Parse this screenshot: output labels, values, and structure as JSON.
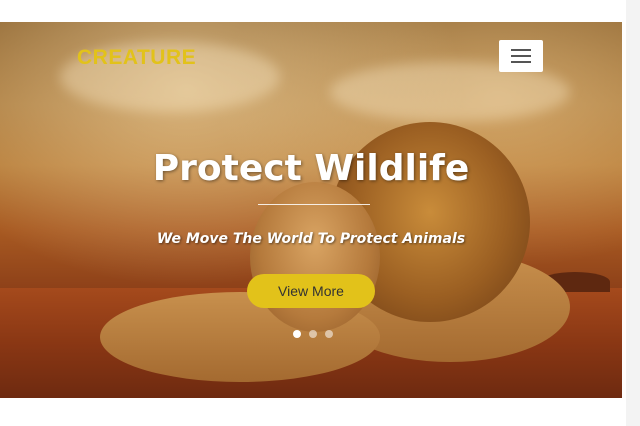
{
  "header": {
    "brand": "CREATURE",
    "menu_icon": "hamburger-menu-icon"
  },
  "hero": {
    "title": "Protect Wildlife",
    "tagline": "We Move The World To Protect Animals",
    "cta_label": "View More",
    "slides": {
      "count": 3,
      "active_index": 0
    }
  },
  "colors": {
    "brand": "#e2c21a",
    "cta_background": "#e2c21a",
    "text_on_hero": "#ffffff"
  }
}
